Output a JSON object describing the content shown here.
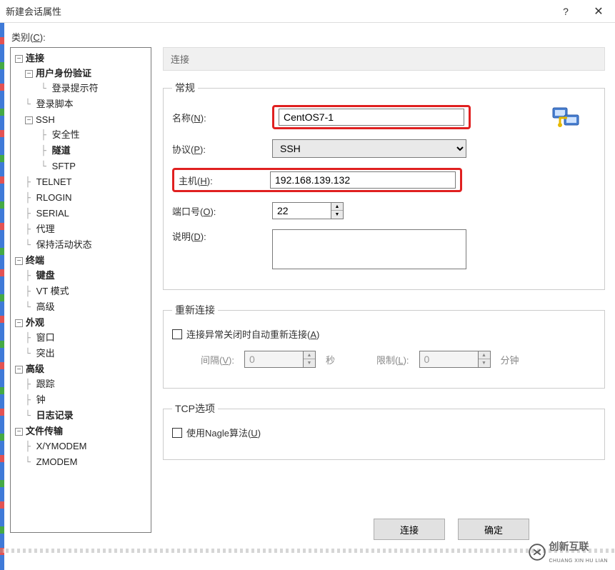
{
  "window": {
    "title": "新建会话属性",
    "help": "?",
    "close": "✕"
  },
  "category_label_prefix": "类别(",
  "category_label_underline": "C",
  "category_label_suffix": "):",
  "tree": {
    "connection": "连接",
    "auth": "用户身份验证",
    "login_prompt": "登录提示符",
    "login_script": "登录脚本",
    "ssh": "SSH",
    "security": "安全性",
    "tunnel": "隧道",
    "sftp": "SFTP",
    "telnet": "TELNET",
    "rlogin": "RLOGIN",
    "serial": "SERIAL",
    "proxy": "代理",
    "keepalive": "保持活动状态",
    "terminal": "终端",
    "keyboard": "键盘",
    "vtmode": "VT 模式",
    "advanced_t": "高级",
    "appearance": "外观",
    "window": "窗口",
    "highlight": "突出",
    "advanced": "高级",
    "trace": "跟踪",
    "bell": "钟",
    "logging": "日志记录",
    "filetransfer": "文件传输",
    "xymodem": "X/YMODEM",
    "zmodem": "ZMODEM"
  },
  "section_title": "连接",
  "general": {
    "legend": "常规",
    "name_label_prefix": "名称(",
    "name_u": "N",
    "name_suffix": "):",
    "name_value": "CentOS7-1",
    "proto_label_prefix": "协议(",
    "proto_u": "P",
    "proto_suffix": "):",
    "proto_value": "SSH",
    "host_label_prefix": "主机(",
    "host_u": "H",
    "host_suffix": "):",
    "host_value": "192.168.139.132",
    "port_label_prefix": "端口号(",
    "port_u": "O",
    "port_suffix": "):",
    "port_value": "22",
    "desc_label_prefix": "说明(",
    "desc_u": "D",
    "desc_suffix": "):",
    "desc_value": ""
  },
  "reconnect": {
    "legend": "重新连接",
    "checkbox_prefix": "连接异常关闭时自动重新连接(",
    "checkbox_u": "A",
    "checkbox_suffix": ")",
    "interval_label_prefix": "间隔(",
    "interval_u": "V",
    "interval_suffix": "):",
    "interval_value": "0",
    "interval_unit": "秒",
    "limit_label_prefix": "限制(",
    "limit_u": "L",
    "limit_suffix": "):",
    "limit_value": "0",
    "limit_unit": "分钟"
  },
  "tcp": {
    "legend": "TCP选项",
    "nagle_prefix": "使用Nagle算法(",
    "nagle_u": "U",
    "nagle_suffix": ")"
  },
  "footer": {
    "connect": "连接",
    "ok": "确定"
  },
  "brand": {
    "cn": "创新互联",
    "en": "CHUANG XIN HU LIAN"
  }
}
